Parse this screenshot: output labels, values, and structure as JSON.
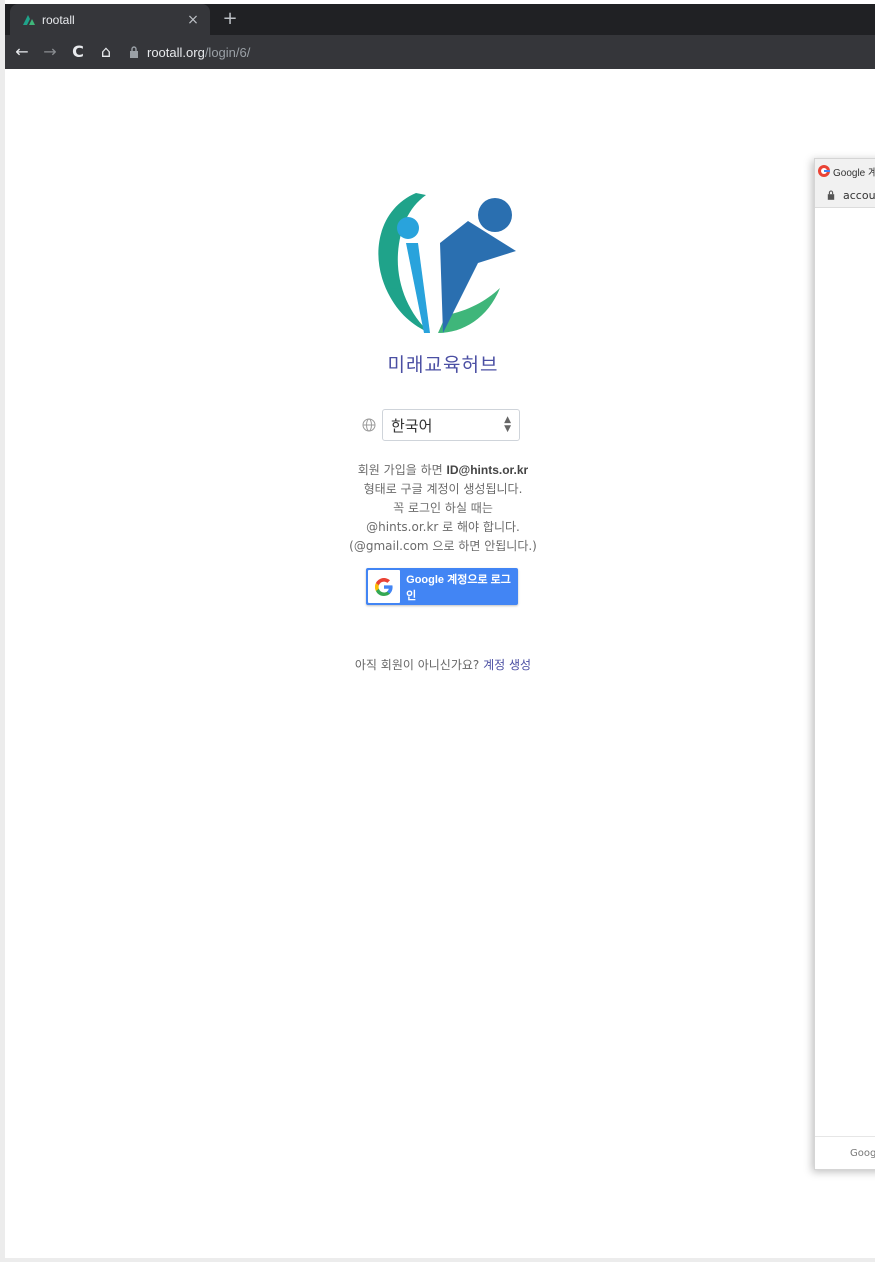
{
  "browser": {
    "tab_title": "rootall",
    "tab_close": "×",
    "new_tab": "+",
    "url_host": "rootall.org",
    "url_path": "/login/6/",
    "back": "←",
    "forward": "→",
    "reload": "C",
    "home": "⌂"
  },
  "login": {
    "brand_name": "미래교육허브",
    "language": {
      "selected": "한국어",
      "icon": "globe-icon"
    },
    "notice": {
      "line1_prefix": "회원 가입을 하면 ",
      "line1_email": "ID@hints.or.kr",
      "line2": "형태로 구글 계정이 생성됩니다.",
      "line3": "꼭 로그인 하실 때는",
      "line4": "@hints.or.kr 로 해야 합니다.",
      "line5": "(@gmail.com 으로 하면 안됩니다.)"
    },
    "google_button_label": "Google 계정으로 로그인",
    "signup_text": "아직 회원이 아니신가요?",
    "signup_link": "계정 생성"
  },
  "popup": {
    "title": "Google 계",
    "url": "accoun",
    "footer": "Googl"
  },
  "colors": {
    "brand": "#4b4fa3",
    "google_blue": "#4285f4",
    "logo_teal": "#1fa38a",
    "logo_blue": "#2a6fb0",
    "logo_light_blue": "#29a3dc",
    "logo_green": "#3fb67a"
  }
}
